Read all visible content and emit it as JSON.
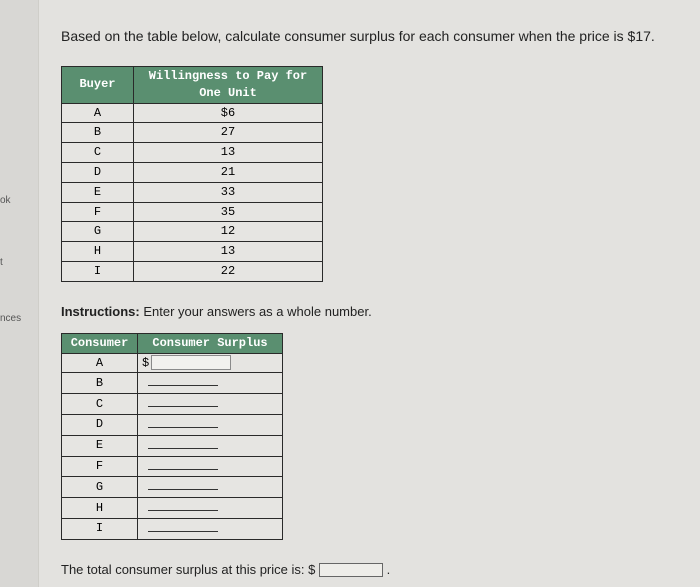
{
  "sidebar": {
    "label_ok": "ok",
    "label_t": "t",
    "label_nces": "nces"
  },
  "question": "Based on the table below, calculate consumer surplus for each consumer when the price is $17.",
  "wtp_table": {
    "header_buyer": "Buyer",
    "header_wtp": "Willingness to Pay for One Unit",
    "rows": [
      {
        "buyer": "A",
        "wtp": "$6"
      },
      {
        "buyer": "B",
        "wtp": "27"
      },
      {
        "buyer": "C",
        "wtp": "13"
      },
      {
        "buyer": "D",
        "wtp": "21"
      },
      {
        "buyer": "E",
        "wtp": "33"
      },
      {
        "buyer": "F",
        "wtp": "35"
      },
      {
        "buyer": "G",
        "wtp": "12"
      },
      {
        "buyer": "H",
        "wtp": "13"
      },
      {
        "buyer": "I",
        "wtp": "22"
      }
    ]
  },
  "instructions_label": "Instructions:",
  "instructions_text": " Enter your answers as a whole number.",
  "cs_table": {
    "header_consumer": "Consumer",
    "header_surplus": "Consumer Surplus",
    "dollar": "$",
    "rows": [
      {
        "consumer": "A",
        "first": true
      },
      {
        "consumer": "B"
      },
      {
        "consumer": "C"
      },
      {
        "consumer": "D"
      },
      {
        "consumer": "E"
      },
      {
        "consumer": "F"
      },
      {
        "consumer": "G"
      },
      {
        "consumer": "H"
      },
      {
        "consumer": "I"
      }
    ]
  },
  "total_text_before": "The total consumer surplus at this price is: $ ",
  "total_text_after": " ."
}
